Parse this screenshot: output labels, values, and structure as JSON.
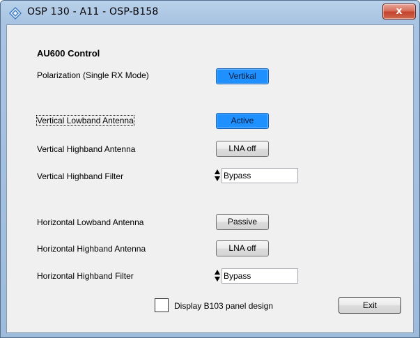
{
  "window": {
    "title": "OSP 130 - A11 - OSP-B158",
    "close_label": "x"
  },
  "panel": {
    "heading": "AU600 Control",
    "polarization": {
      "label": "Polarization (Single RX Mode)",
      "button": "Vertikal"
    },
    "vertical_lowband": {
      "label": "Vertical Lowband Antenna",
      "button": "Active"
    },
    "vertical_highband": {
      "label": "Vertical Highband Antenna",
      "button": "LNA off"
    },
    "vertical_filter": {
      "label": "Vertical Highband Filter",
      "value": "Bypass"
    },
    "horizontal_lowband": {
      "label": "Horizontal Lowband Antenna",
      "button": "Passive"
    },
    "horizontal_highband": {
      "label": "Horizontal Highband Antenna",
      "button": "LNA off"
    },
    "horizontal_filter": {
      "label": "Horizontal Highband Filter",
      "value": "Bypass"
    },
    "display_b103": {
      "label": "Display B103 panel design",
      "checked": false
    },
    "exit_button": "Exit"
  },
  "colors": {
    "active_button": "#1e90ff",
    "dialog_background": "#f0f0f0",
    "close_button": "#c2412b"
  }
}
